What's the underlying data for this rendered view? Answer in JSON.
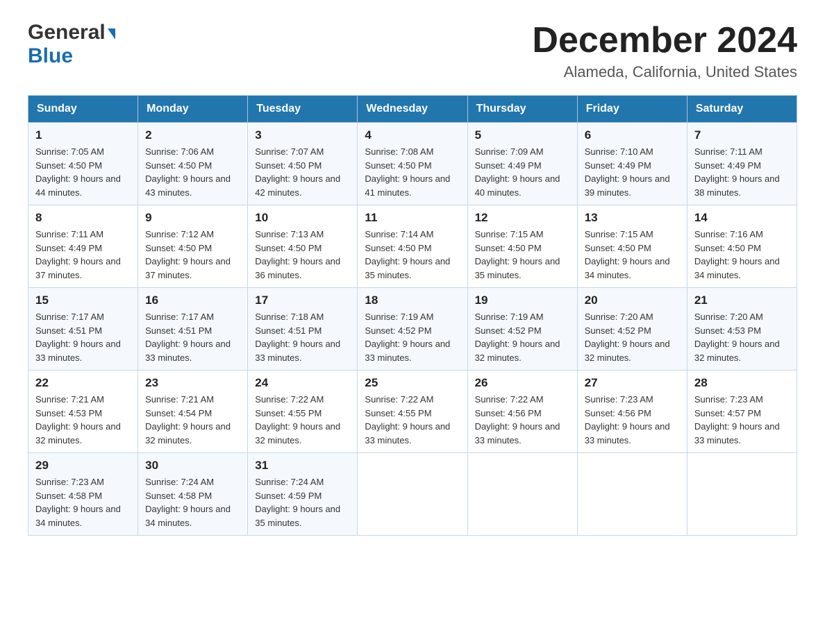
{
  "header": {
    "logo_general": "General",
    "logo_blue": "Blue",
    "month_title": "December 2024",
    "location": "Alameda, California, United States"
  },
  "calendar": {
    "days_of_week": [
      "Sunday",
      "Monday",
      "Tuesday",
      "Wednesday",
      "Thursday",
      "Friday",
      "Saturday"
    ],
    "weeks": [
      [
        {
          "day": "1",
          "sunrise": "7:05 AM",
          "sunset": "4:50 PM",
          "daylight": "9 hours and 44 minutes."
        },
        {
          "day": "2",
          "sunrise": "7:06 AM",
          "sunset": "4:50 PM",
          "daylight": "9 hours and 43 minutes."
        },
        {
          "day": "3",
          "sunrise": "7:07 AM",
          "sunset": "4:50 PM",
          "daylight": "9 hours and 42 minutes."
        },
        {
          "day": "4",
          "sunrise": "7:08 AM",
          "sunset": "4:50 PM",
          "daylight": "9 hours and 41 minutes."
        },
        {
          "day": "5",
          "sunrise": "7:09 AM",
          "sunset": "4:49 PM",
          "daylight": "9 hours and 40 minutes."
        },
        {
          "day": "6",
          "sunrise": "7:10 AM",
          "sunset": "4:49 PM",
          "daylight": "9 hours and 39 minutes."
        },
        {
          "day": "7",
          "sunrise": "7:11 AM",
          "sunset": "4:49 PM",
          "daylight": "9 hours and 38 minutes."
        }
      ],
      [
        {
          "day": "8",
          "sunrise": "7:11 AM",
          "sunset": "4:49 PM",
          "daylight": "9 hours and 37 minutes."
        },
        {
          "day": "9",
          "sunrise": "7:12 AM",
          "sunset": "4:50 PM",
          "daylight": "9 hours and 37 minutes."
        },
        {
          "day": "10",
          "sunrise": "7:13 AM",
          "sunset": "4:50 PM",
          "daylight": "9 hours and 36 minutes."
        },
        {
          "day": "11",
          "sunrise": "7:14 AM",
          "sunset": "4:50 PM",
          "daylight": "9 hours and 35 minutes."
        },
        {
          "day": "12",
          "sunrise": "7:15 AM",
          "sunset": "4:50 PM",
          "daylight": "9 hours and 35 minutes."
        },
        {
          "day": "13",
          "sunrise": "7:15 AM",
          "sunset": "4:50 PM",
          "daylight": "9 hours and 34 minutes."
        },
        {
          "day": "14",
          "sunrise": "7:16 AM",
          "sunset": "4:50 PM",
          "daylight": "9 hours and 34 minutes."
        }
      ],
      [
        {
          "day": "15",
          "sunrise": "7:17 AM",
          "sunset": "4:51 PM",
          "daylight": "9 hours and 33 minutes."
        },
        {
          "day": "16",
          "sunrise": "7:17 AM",
          "sunset": "4:51 PM",
          "daylight": "9 hours and 33 minutes."
        },
        {
          "day": "17",
          "sunrise": "7:18 AM",
          "sunset": "4:51 PM",
          "daylight": "9 hours and 33 minutes."
        },
        {
          "day": "18",
          "sunrise": "7:19 AM",
          "sunset": "4:52 PM",
          "daylight": "9 hours and 33 minutes."
        },
        {
          "day": "19",
          "sunrise": "7:19 AM",
          "sunset": "4:52 PM",
          "daylight": "9 hours and 32 minutes."
        },
        {
          "day": "20",
          "sunrise": "7:20 AM",
          "sunset": "4:52 PM",
          "daylight": "9 hours and 32 minutes."
        },
        {
          "day": "21",
          "sunrise": "7:20 AM",
          "sunset": "4:53 PM",
          "daylight": "9 hours and 32 minutes."
        }
      ],
      [
        {
          "day": "22",
          "sunrise": "7:21 AM",
          "sunset": "4:53 PM",
          "daylight": "9 hours and 32 minutes."
        },
        {
          "day": "23",
          "sunrise": "7:21 AM",
          "sunset": "4:54 PM",
          "daylight": "9 hours and 32 minutes."
        },
        {
          "day": "24",
          "sunrise": "7:22 AM",
          "sunset": "4:55 PM",
          "daylight": "9 hours and 32 minutes."
        },
        {
          "day": "25",
          "sunrise": "7:22 AM",
          "sunset": "4:55 PM",
          "daylight": "9 hours and 33 minutes."
        },
        {
          "day": "26",
          "sunrise": "7:22 AM",
          "sunset": "4:56 PM",
          "daylight": "9 hours and 33 minutes."
        },
        {
          "day": "27",
          "sunrise": "7:23 AM",
          "sunset": "4:56 PM",
          "daylight": "9 hours and 33 minutes."
        },
        {
          "day": "28",
          "sunrise": "7:23 AM",
          "sunset": "4:57 PM",
          "daylight": "9 hours and 33 minutes."
        }
      ],
      [
        {
          "day": "29",
          "sunrise": "7:23 AM",
          "sunset": "4:58 PM",
          "daylight": "9 hours and 34 minutes."
        },
        {
          "day": "30",
          "sunrise": "7:24 AM",
          "sunset": "4:58 PM",
          "daylight": "9 hours and 34 minutes."
        },
        {
          "day": "31",
          "sunrise": "7:24 AM",
          "sunset": "4:59 PM",
          "daylight": "9 hours and 35 minutes."
        },
        null,
        null,
        null,
        null
      ]
    ]
  }
}
